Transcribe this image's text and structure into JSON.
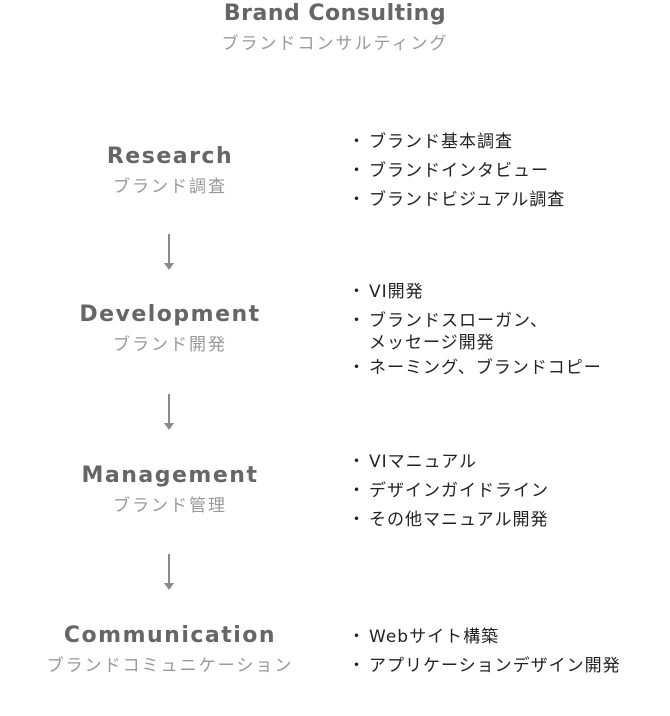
{
  "header": {
    "title": "Brand Consulting",
    "subtitle": "ブランドコンサルティング"
  },
  "stages": [
    {
      "en": "Research",
      "jp": "ブランド調査",
      "items": [
        "ブランド基本調査",
        "ブランドインタビュー",
        "ブランドビジュアル調査"
      ]
    },
    {
      "en": "Development",
      "jp": "ブランド開発",
      "items": [
        "VI開発",
        "ブランドスローガン、",
        "メッセージ開発",
        "ネーミング、ブランドコピー"
      ]
    },
    {
      "en": "Management",
      "jp": "ブランド管理",
      "items": [
        "VIマニュアル",
        "デザインガイドライン",
        "その他マニュアル開発"
      ]
    },
    {
      "en": "Communication",
      "jp": "ブランドコミュニケーション",
      "items": [
        "Webサイト構築",
        "アプリケーションデザイン開発"
      ]
    }
  ],
  "colors": {
    "heading": "#666666",
    "subheading": "#999999",
    "arrow": "#8a8a8a",
    "item_text": "#222222"
  }
}
